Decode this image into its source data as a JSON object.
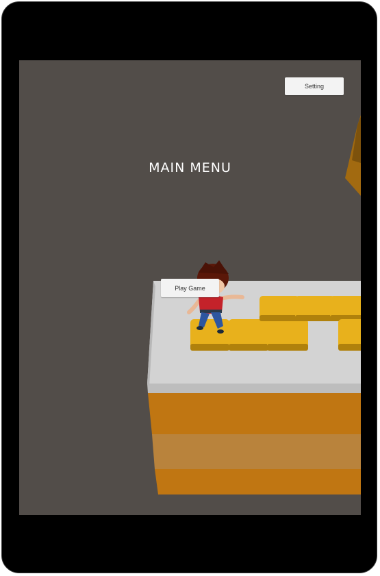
{
  "menu": {
    "title": "MAIN MENU",
    "setting_label": "Setting",
    "play_label": "Play Game"
  },
  "colors": {
    "background": "#524d49",
    "platform_top": "#d4d4d4",
    "platform_side": "#c47a13",
    "tile": "#e5ad1a",
    "button": "#f3f3f3"
  }
}
